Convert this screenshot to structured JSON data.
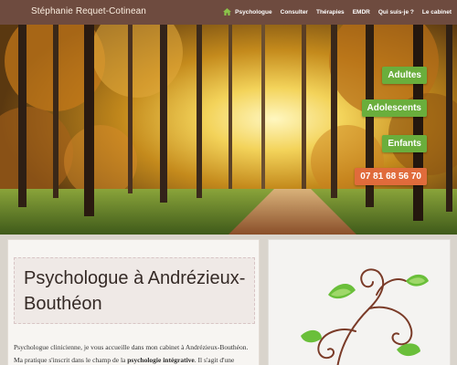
{
  "brand": {
    "name": "Stéphanie Requet-Cotinean"
  },
  "nav": {
    "items": [
      {
        "label": "Psychologue",
        "name": "nav-psychologue"
      },
      {
        "label": "Consulter",
        "name": "nav-consulter"
      },
      {
        "label": "Thérapies",
        "name": "nav-therapies"
      },
      {
        "label": "EMDR",
        "name": "nav-emdr"
      },
      {
        "label": "Qui suis-je ?",
        "name": "nav-qui-suis-je"
      },
      {
        "label": "Le cabinet",
        "name": "nav-le-cabinet"
      }
    ],
    "home_icon": "home-icon"
  },
  "hero": {
    "buttons": {
      "adultes": "Adultes",
      "adolescents": "Adolescents",
      "enfants": "Enfants",
      "phone": "07 81 68 56 70"
    },
    "colors": {
      "green": "#6aae3c",
      "orange": "#e06b3b"
    }
  },
  "main": {
    "title": "Psychologue à Andrézieux-Bouthéon",
    "para1": "Psychologue clinicienne, je vous accueille dans mon cabinet à Andrézieux-Bouthéon.",
    "para2_start": "Ma pratique s'inscrit dans le champ de la ",
    "para2_bold": "psychologie intégrative",
    "para2_end": ". Il s'agit d'une"
  },
  "colors": {
    "topbar": "#6e4b3f",
    "accent_green": "#6aae3c",
    "accent_orange": "#e06b3b"
  }
}
